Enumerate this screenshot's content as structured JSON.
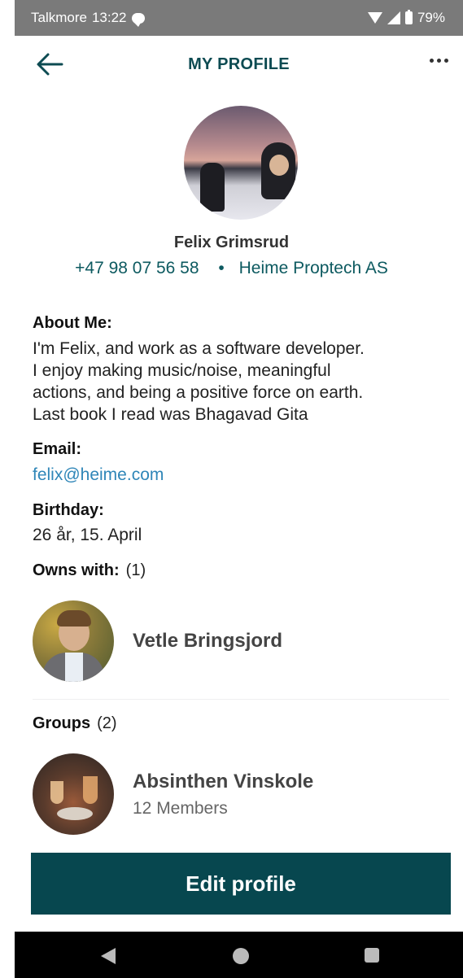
{
  "status_bar": {
    "carrier": "Talkmore",
    "time": "13:22",
    "battery": "79%"
  },
  "header": {
    "title": "MY PROFILE"
  },
  "profile": {
    "name": "Felix Grimsrud",
    "phone": "+47 98 07 56 58",
    "separator": "•",
    "company": "Heime Proptech AS"
  },
  "about": {
    "label": "About Me:",
    "lines": [
      "I'm Felix, and work as a software developer.",
      "I enjoy making music/noise, meaningful",
      "actions, and being a positive force on earth.",
      "Last book I read was Bhagavad Gita"
    ]
  },
  "email": {
    "label": "Email:",
    "value": "felix@heime.com"
  },
  "birthday": {
    "label": "Birthday:",
    "value": "26 år, 15. April"
  },
  "owns_with": {
    "label": "Owns with:",
    "count": "(1)",
    "people": [
      {
        "name": "Vetle Bringsjord"
      }
    ]
  },
  "groups": {
    "label": "Groups",
    "count": "(2)",
    "items": [
      {
        "name": "Absinthen Vinskole",
        "members": "12 Members"
      }
    ]
  },
  "actions": {
    "edit_profile": "Edit profile"
  },
  "colors": {
    "accent": "#0d4b52",
    "button": "#07474f",
    "link": "#2f86b8"
  }
}
